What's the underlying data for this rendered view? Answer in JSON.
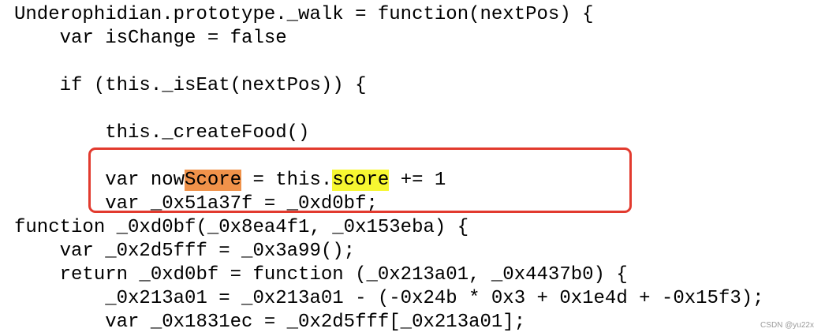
{
  "code": {
    "lines": [
      "Underophidian.prototype._walk = function(nextPos) {",
      "    var isChange = false",
      "",
      "    if (this._isEat(nextPos)) {",
      "",
      "        this._createFood()",
      "",
      "        var nowScore = this.score += 1",
      "        var _0x51a37f = _0xd0bf;",
      "function _0xd0bf(_0x8ea4f1, _0x153eba) {",
      "    var _0x2d5fff = _0x3a99();",
      "    return _0xd0bf = function (_0x213a01, _0x4437b0) {",
      "        _0x213a01 = _0x213a01 - (-0x24b * 0x3 + 0x1e4d + -0x15f3);",
      "        var _0x1831ec = _0x2d5fff[_0x213a01];"
    ],
    "score_line_parts": {
      "before": "        var now",
      "highlight_orange": "Score",
      "middle": " = this.",
      "highlight_yellow": "score",
      "after": " += 1"
    }
  },
  "annotation": {
    "box_color": "#e23a2e",
    "orange_highlight": "#f0924a",
    "yellow_highlight": "#f7f731"
  },
  "watermark": "CSDN @yu22x"
}
